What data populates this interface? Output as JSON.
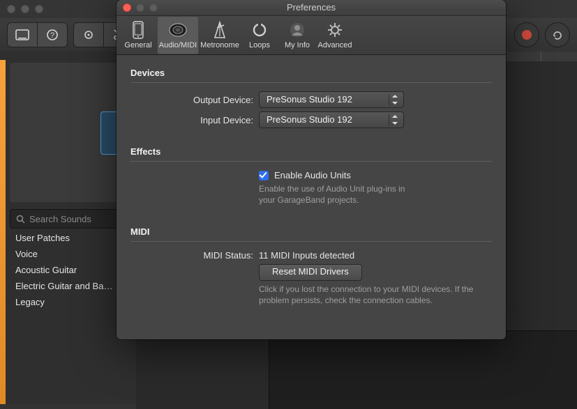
{
  "mainWindow": {
    "search_placeholder": "Search Sounds",
    "sidebar": [
      "User Patches",
      "Voice",
      "Acoustic Guitar",
      "Electric Guitar and Ba…",
      "Legacy"
    ]
  },
  "prefs": {
    "title": "Preferences",
    "tabs": {
      "general": "General",
      "audio": "Audio/MIDI",
      "metronome": "Metronome",
      "loops": "Loops",
      "myinfo": "My Info",
      "advanced": "Advanced"
    },
    "devices": {
      "heading": "Devices",
      "output_label": "Output Device:",
      "output_value": "PreSonus Studio 192",
      "input_label": "Input Device:",
      "input_value": "PreSonus Studio 192"
    },
    "effects": {
      "heading": "Effects",
      "checkbox_label": "Enable Audio Units",
      "hint": "Enable the use of Audio Unit plug-ins in your GarageBand projects."
    },
    "midi": {
      "heading": "MIDI",
      "status_label": "MIDI Status:",
      "status_value": "11 MIDI Inputs detected",
      "reset_label": "Reset MIDI Drivers",
      "hint": "Click if you lost the connection to your MIDI devices. If the problem persists, check the connection cables."
    }
  }
}
